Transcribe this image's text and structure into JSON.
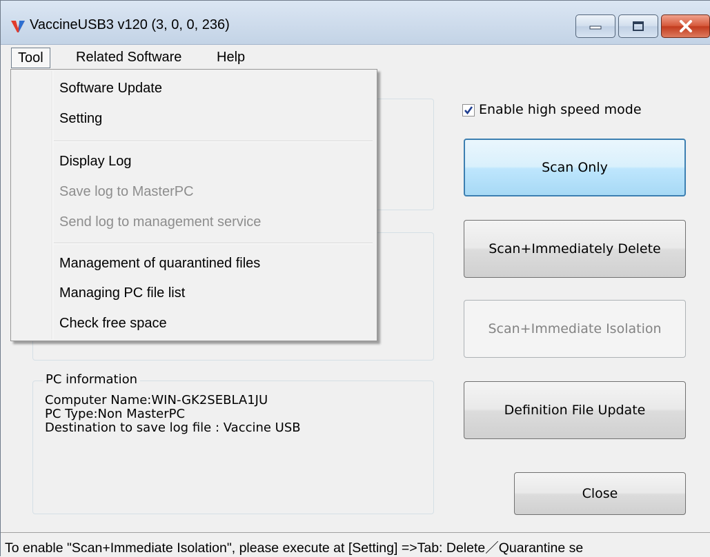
{
  "window": {
    "title": "VaccineUSB3 v120 (3, 0, 0, 236)"
  },
  "menubar": {
    "tool": "Tool",
    "related_software": "Related Software",
    "help": "Help"
  },
  "tool_menu": {
    "items": [
      {
        "label": "Software Update",
        "enabled": true
      },
      {
        "label": "Setting",
        "enabled": true
      },
      {
        "label": "Display Log",
        "enabled": true
      },
      {
        "label": "Save log to MasterPC",
        "enabled": false
      },
      {
        "label": "Send log to management service",
        "enabled": false
      },
      {
        "label": "Management of quarantined files",
        "enabled": true
      },
      {
        "label": "Managing PC file list",
        "enabled": true
      },
      {
        "label": "Check free space",
        "enabled": true
      }
    ]
  },
  "options": {
    "high_speed_label": "Enable high speed mode",
    "high_speed_checked": true
  },
  "buttons": {
    "scan_only": "Scan Only",
    "scan_delete": "Scan+Immediately Delete",
    "scan_isolation": "Scan+Immediate Isolation",
    "definition_update": "Definition File Update",
    "close": "Close"
  },
  "pc_information": {
    "title": "PC information",
    "computer_name": "Computer Name:WIN-GK2SEBLA1JU",
    "pc_type": "PC Type:Non MasterPC",
    "log_destination": "Destination to save log file : Vaccine USB"
  },
  "status": {
    "message": "To enable \"Scan+Immediate Isolation\", please execute at [Setting] =>Tab: Delete／Quarantine se"
  },
  "colors": {
    "accent_border": "#3c7fb1",
    "close_button": "#c23b1e",
    "disabled_text": "#8d8d8d"
  }
}
